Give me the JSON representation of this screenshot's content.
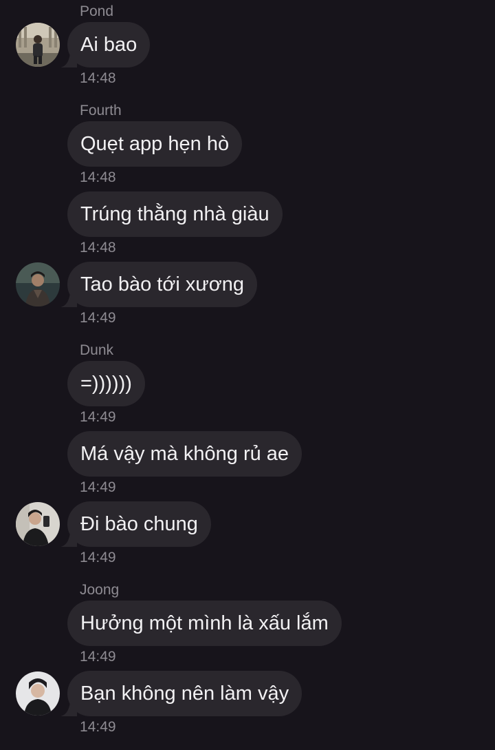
{
  "messages": [
    {
      "sender": "Pond",
      "text": "Ai bao",
      "time": "14:48"
    },
    {
      "sender": "Fourth",
      "text": "Quẹt app hẹn hò",
      "time": "14:48"
    },
    {
      "text": "Trúng thằng nhà giàu",
      "time": "14:48"
    },
    {
      "text": "Tao bào tới xương",
      "time": "14:49"
    },
    {
      "sender": "Dunk",
      "text": "=))))))",
      "time": "14:49"
    },
    {
      "text": "Má vậy mà không rủ ae",
      "time": "14:49"
    },
    {
      "text": "Đi bào chung",
      "time": "14:49"
    },
    {
      "sender": "Joong",
      "text": "Hưởng một mình là xấu lắm",
      "time": "14:49"
    },
    {
      "text": "Bạn không nên làm vậy",
      "time": "14:49"
    }
  ],
  "colors": {
    "background": "#17141b",
    "bubble": "#2a272d",
    "meta_text": "#8e8b92",
    "message_text": "#f2f1f3"
  }
}
